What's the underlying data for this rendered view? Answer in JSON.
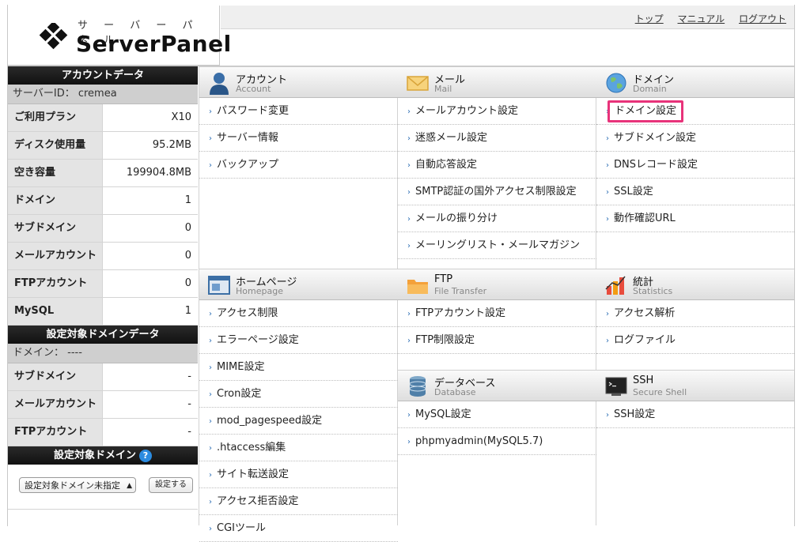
{
  "header": {
    "logo_kana": "サ ー バ ー パ ネ ル",
    "logo_brand": "ServerPanel",
    "links": [
      "トップ",
      "マニュアル",
      "ログアウト"
    ]
  },
  "sidebar": {
    "account_title": "アカウントデータ",
    "server_id": "サーバーID： cremea",
    "account_rows": [
      {
        "k": "ご利用プラン",
        "v": "X10"
      },
      {
        "k": "ディスク使用量",
        "v": "95.2MB"
      },
      {
        "k": "空き容量",
        "v": "199904.8MB"
      },
      {
        "k": "ドメイン",
        "v": "1"
      },
      {
        "k": "サブドメイン",
        "v": "0"
      },
      {
        "k": "メールアカウント",
        "v": "0"
      },
      {
        "k": "FTPアカウント",
        "v": "0"
      },
      {
        "k": "MySQL",
        "v": "1"
      }
    ],
    "domain_title": "設定対象ドメインデータ",
    "domain_sub": "ドメイン： ----",
    "domain_rows": [
      {
        "k": "サブドメイン",
        "v": "-"
      },
      {
        "k": "メールアカウント",
        "v": "-"
      },
      {
        "k": "FTPアカウント",
        "v": "-"
      }
    ],
    "target_title": "設定対象ドメイン",
    "help": "?",
    "select_value": "設定対象ドメイン未指定",
    "set_button": "設定する"
  },
  "sections": {
    "account": {
      "jp": "アカウント",
      "en": "Account",
      "items": [
        "パスワード変更",
        "サーバー情報",
        "バックアップ"
      ]
    },
    "mail": {
      "jp": "メール",
      "en": "Mail",
      "items": [
        "メールアカウント設定",
        "迷惑メール設定",
        "自動応答設定",
        "SMTP認証の国外アクセス制限設定",
        "メールの振り分け",
        "メーリングリスト・メールマガジン"
      ]
    },
    "domain": {
      "jp": "ドメイン",
      "en": "Domain",
      "items": [
        "ドメイン設定",
        "サブドメイン設定",
        "DNSレコード設定",
        "SSL設定",
        "動作確認URL"
      ]
    },
    "homepage": {
      "jp": "ホームページ",
      "en": "Homepage",
      "items": [
        "アクセス制限",
        "エラーページ設定",
        "MIME設定",
        "Cron設定",
        "mod_pagespeed設定",
        ".htaccess編集",
        "サイト転送設定",
        "アクセス拒否設定",
        "CGIツール"
      ]
    },
    "ftp": {
      "jp": "FTP",
      "en": "File Transfer",
      "items": [
        "FTPアカウント設定",
        "FTP制限設定"
      ]
    },
    "stats": {
      "jp": "統計",
      "en": "Statistics",
      "items": [
        "アクセス解析",
        "ログファイル"
      ]
    },
    "database": {
      "jp": "データベース",
      "en": "Database",
      "items": [
        "MySQL設定",
        "phpmyadmin(MySQL5.7)"
      ]
    },
    "ssh": {
      "jp": "SSH",
      "en": "Secure Shell",
      "items": [
        "SSH設定"
      ]
    }
  }
}
